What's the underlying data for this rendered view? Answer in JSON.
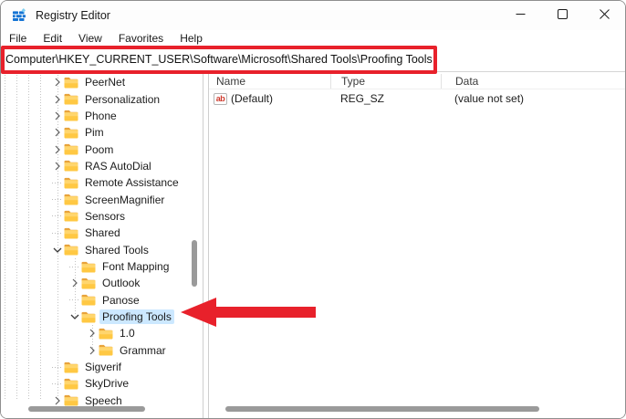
{
  "window": {
    "title": "Registry Editor",
    "controls": [
      {
        "name": "minimize",
        "glyph": "minimize-icon"
      },
      {
        "name": "maximize",
        "glyph": "maximize-icon"
      },
      {
        "name": "close",
        "glyph": "close-icon"
      }
    ]
  },
  "menu": {
    "items": [
      "File",
      "Edit",
      "View",
      "Favorites",
      "Help"
    ]
  },
  "address_bar": {
    "value": "Computer\\HKEY_CURRENT_USER\\Software\\Microsoft\\Shared Tools\\Proofing Tools"
  },
  "tree": {
    "items": [
      {
        "label": "PeerNet",
        "level": 0,
        "state": "collapsed"
      },
      {
        "label": "Personalization",
        "level": 0,
        "state": "collapsed"
      },
      {
        "label": "Phone",
        "level": 0,
        "state": "collapsed"
      },
      {
        "label": "Pim",
        "level": 0,
        "state": "collapsed"
      },
      {
        "label": "Poom",
        "level": 0,
        "state": "collapsed"
      },
      {
        "label": "RAS AutoDial",
        "level": 0,
        "state": "collapsed"
      },
      {
        "label": "Remote Assistance",
        "level": 0,
        "state": "leaf"
      },
      {
        "label": "ScreenMagnifier",
        "level": 0,
        "state": "leaf"
      },
      {
        "label": "Sensors",
        "level": 0,
        "state": "leaf"
      },
      {
        "label": "Shared",
        "level": 0,
        "state": "leaf"
      },
      {
        "label": "Shared Tools",
        "level": 0,
        "state": "expanded"
      },
      {
        "label": "Font Mapping",
        "level": 1,
        "state": "leaf"
      },
      {
        "label": "Outlook",
        "level": 1,
        "state": "collapsed"
      },
      {
        "label": "Panose",
        "level": 1,
        "state": "leaf"
      },
      {
        "label": "Proofing Tools",
        "level": 1,
        "state": "expanded",
        "selected": true
      },
      {
        "label": "1.0",
        "level": 2,
        "state": "collapsed"
      },
      {
        "label": "Grammar",
        "level": 2,
        "state": "collapsed"
      },
      {
        "label": "Sigverif",
        "level": 0,
        "state": "leaf"
      },
      {
        "label": "SkyDrive",
        "level": 0,
        "state": "leaf"
      },
      {
        "label": "Speech",
        "level": 0,
        "state": "collapsed"
      }
    ]
  },
  "list": {
    "columns": [
      "Name",
      "Type",
      "Data"
    ],
    "rows": [
      {
        "icon": "reg-sz-string-icon",
        "icon_label": "ab",
        "name": "(Default)",
        "type": "REG_SZ",
        "data": "(value not set)"
      }
    ]
  },
  "annotations": {
    "highlight_color": "#e8212b",
    "arrow_color": "#e8212b"
  },
  "colors": {
    "selection": "#cce8ff",
    "folder": "#ffc843"
  }
}
